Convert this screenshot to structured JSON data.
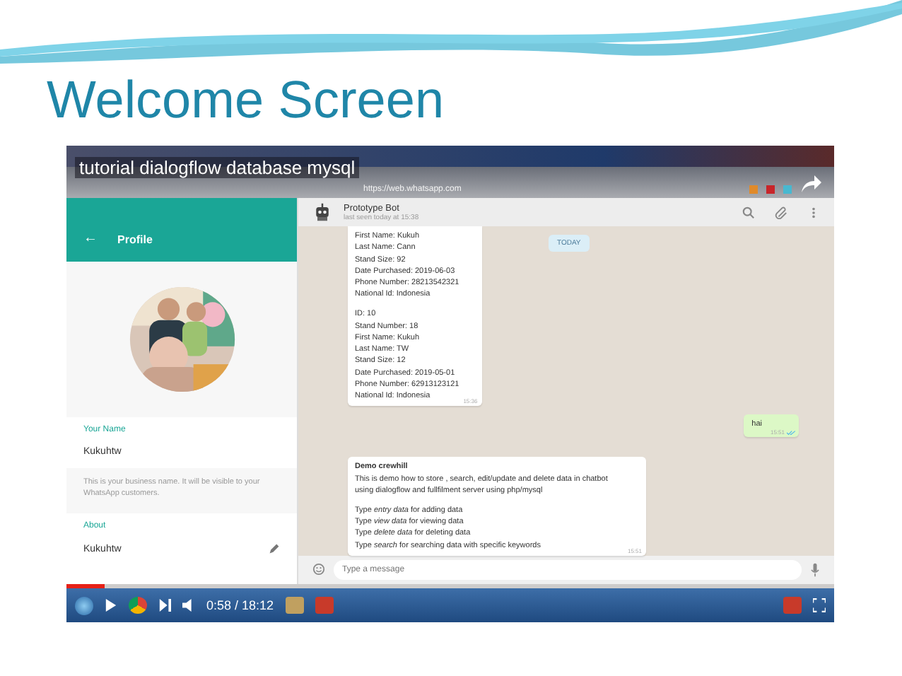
{
  "slide": {
    "title": "Welcome Screen"
  },
  "video": {
    "title": "tutorial dialogflow database mysql",
    "time": "0:58 / 18:12",
    "level": 0.05
  },
  "browser": {
    "address": "https://web.whatsapp.com"
  },
  "profile": {
    "header": "Profile",
    "back": "←",
    "name_label": "Your Name",
    "name": "Kukuhtw",
    "hint": "This is your business name. It will be visible to your WhatsApp customers.",
    "about_label": "About",
    "about": "Kukuhtw"
  },
  "chat": {
    "name": "Prototype Bot",
    "status": "last seen today at 15:38",
    "date_pill": "TODAY",
    "messages": [
      {
        "kind": "incoming",
        "paragraphs": [
          [
            "First Name: Kukuh",
            "Last Name: Cann",
            "Stand Size: 92",
            "Date Purchased: 2019-06-03",
            "Phone Number: 28213542321",
            "National Id: Indonesia"
          ],
          [
            "ID: 10",
            "Stand Number: 18",
            "First Name: Kukuh",
            "Last Name: TW",
            "Stand Size: 12",
            "Date Purchased: 2019-05-01",
            "Phone Number: 62913123121",
            "National Id: Indonesia"
          ]
        ],
        "time": "15:36"
      },
      {
        "kind": "outgoing",
        "paragraphs": [
          [
            "hai"
          ]
        ],
        "time": "15:51"
      },
      {
        "kind": "incoming",
        "heading": "Demo crewhill",
        "paragraphs": [
          [
            "This is demo how to store , search, edit/update and delete data in chatbot using dialogflow and fullfilment server using php/mysql"
          ],
          [
            "Type *entry data* for adding data",
            "Type *view data* for viewing data",
            "Type *delete data* for deleting data",
            "Type *search* for searching data with specific keywords"
          ]
        ],
        "time": "15:51"
      }
    ],
    "input_placeholder": "Type a message"
  }
}
